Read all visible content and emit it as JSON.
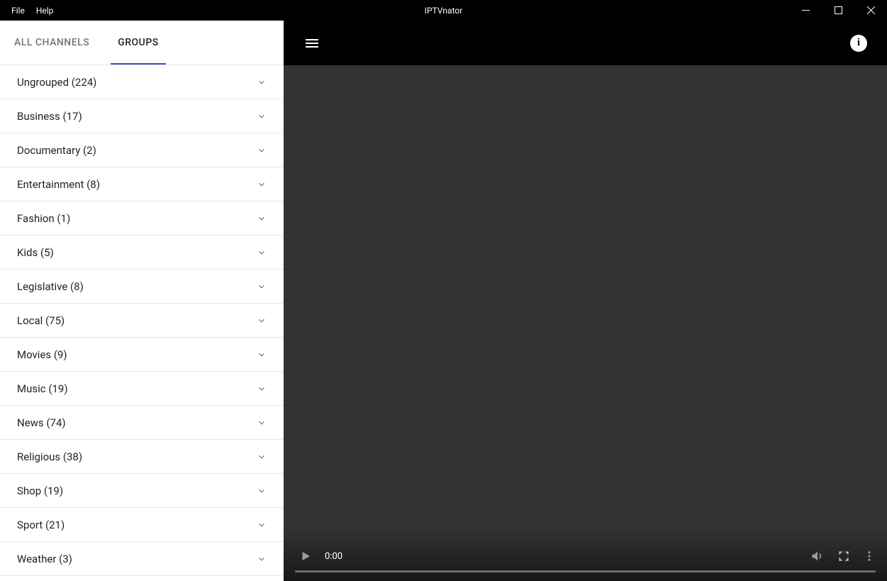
{
  "window": {
    "menu": {
      "file": "File",
      "help": "Help"
    },
    "title": "IPTVnator"
  },
  "tabs": {
    "all_channels": "ALL CHANNELS",
    "groups": "GROUPS",
    "active": "groups"
  },
  "groups": [
    {
      "label": "Ungrouped (224)"
    },
    {
      "label": "Business (17)"
    },
    {
      "label": "Documentary (2)"
    },
    {
      "label": "Entertainment (8)"
    },
    {
      "label": "Fashion (1)"
    },
    {
      "label": "Kids (5)"
    },
    {
      "label": "Legislative (8)"
    },
    {
      "label": "Local (75)"
    },
    {
      "label": "Movies (9)"
    },
    {
      "label": "Music (19)"
    },
    {
      "label": "News (74)"
    },
    {
      "label": "Religious (38)"
    },
    {
      "label": "Shop (19)"
    },
    {
      "label": "Sport (21)"
    },
    {
      "label": "Weather (3)"
    }
  ],
  "player": {
    "current_time": "0:00"
  }
}
